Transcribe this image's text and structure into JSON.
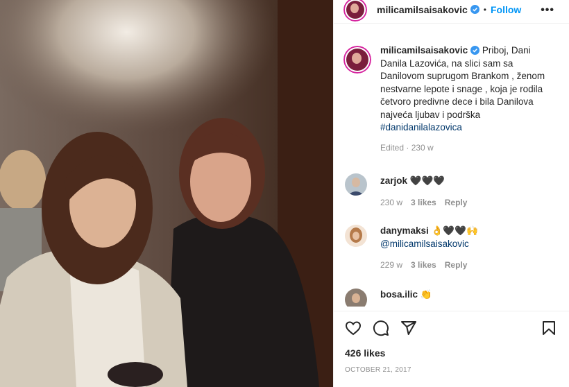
{
  "post": {
    "username": "milicamilsaisakovic",
    "dot": "•",
    "follow_label": "Follow",
    "more_label": "•••",
    "caption": "Priboj, Dani Danila Lazovića, na slici sam sa Danilovom suprugom Brankom , ženom nestvarne lepote i snage , koja je rodila četvoro predivne dece i bila Danilova najveća ljubav i podrška",
    "hashtag": "#danidanilalazovica",
    "caption_meta": "Edited · 230 w",
    "likes": "426 likes",
    "date": "OCTOBER 21, 2017"
  },
  "comments": [
    {
      "username": "zarjok",
      "text": "🖤🖤🖤",
      "age": "230 w",
      "likes": "3 likes",
      "reply": "Reply"
    },
    {
      "username": "danymaksi",
      "text": "👌🖤🖤🙌",
      "mention": "@milicamilsaisakovic",
      "age": "229 w",
      "likes": "3 likes",
      "reply": "Reply"
    },
    {
      "username": "bosa.ilic",
      "text": "👏"
    }
  ],
  "icons": {
    "like": "heart-icon",
    "comment": "comment-icon",
    "share": "share-icon",
    "save": "bookmark-icon",
    "verified": "verified-badge-icon"
  },
  "colors": {
    "accent": "#0095f6",
    "link": "#00376b",
    "muted": "#8e8e8e"
  }
}
